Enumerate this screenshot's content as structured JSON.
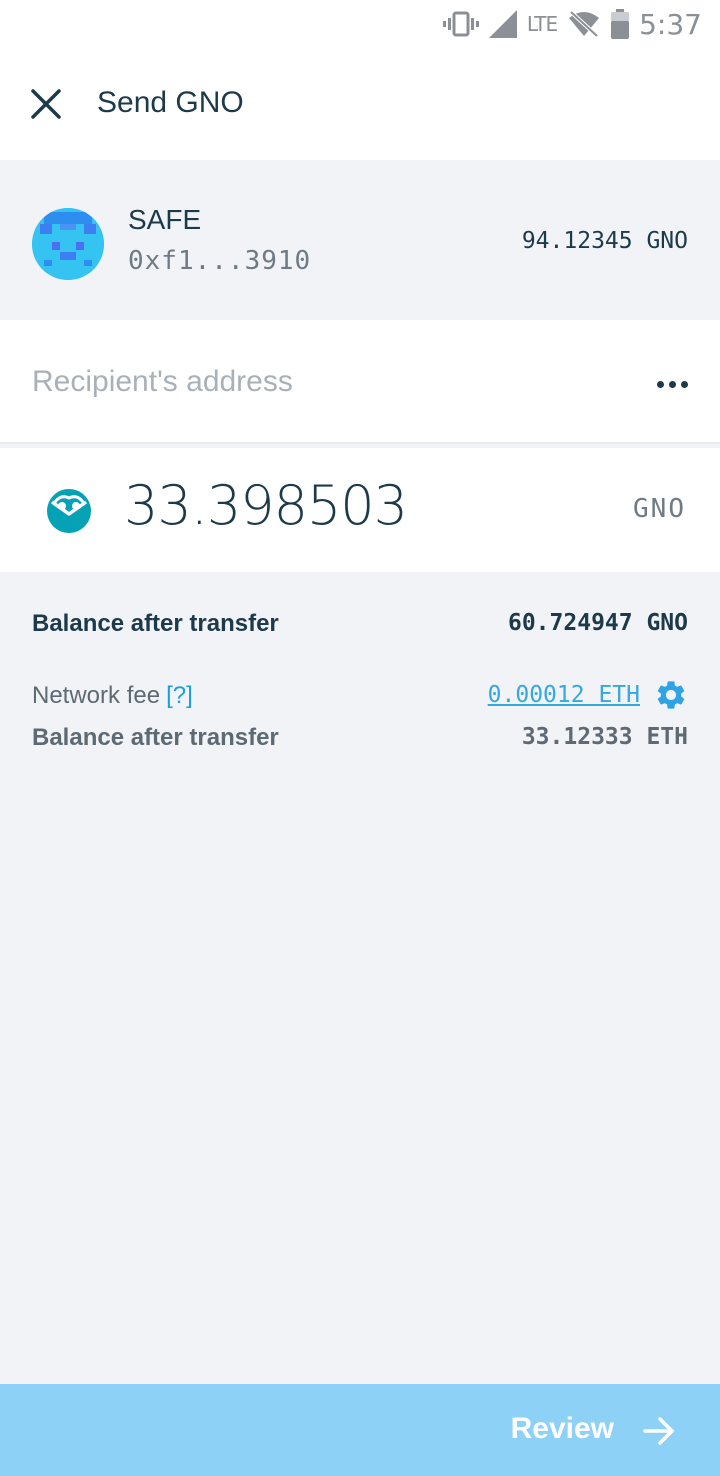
{
  "status_bar": {
    "time": "5:37",
    "network": "LTE",
    "icons": [
      "vibrate-icon",
      "signal-icon",
      "wifi-off-icon",
      "battery-icon"
    ]
  },
  "header": {
    "title": "Send GNO",
    "close_icon": "close-icon"
  },
  "account": {
    "name": "SAFE",
    "address": "0xf1...3910",
    "balance": "94.12345 GNO"
  },
  "recipient": {
    "placeholder": "Recipient's address",
    "value": "",
    "more_icon": "more-horizontal-icon"
  },
  "amount": {
    "value": "33.398503",
    "symbol": "GNO",
    "token_icon": "gnosis-owl-icon"
  },
  "summary": {
    "token_balance_label": "Balance after transfer",
    "token_balance_value": "60.724947 GNO",
    "fee_label": "Network fee",
    "fee_help": "[?]",
    "fee_value": "0.00012 ETH",
    "fee_settings_icon": "gear-icon",
    "eth_balance_label": "Balance after transfer",
    "eth_balance_value": "33.12333 ETH"
  },
  "footer": {
    "review_label": "Review",
    "arrow_icon": "arrow-right-icon"
  },
  "colors": {
    "accent": "#35a8e0",
    "footer_bg": "#8dd1f6",
    "text_dark": "#1d3a4a",
    "page_bg": "#f2f3f7"
  }
}
